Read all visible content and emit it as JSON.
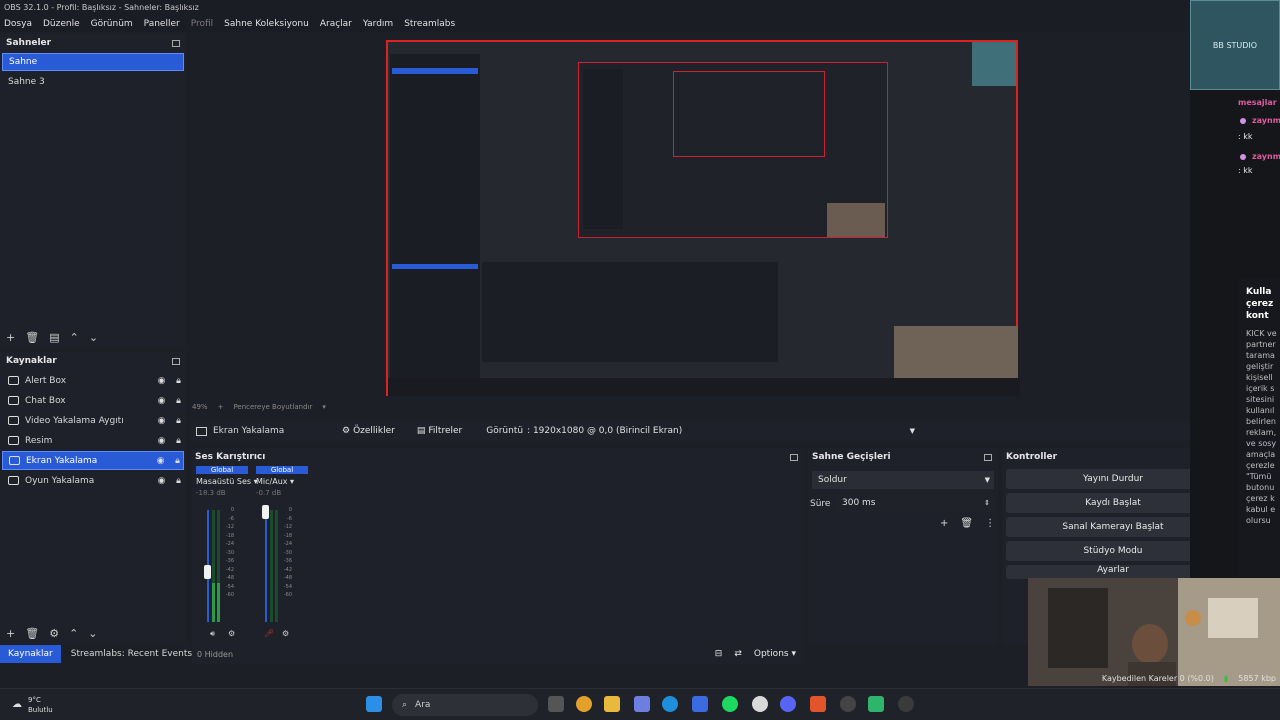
{
  "window": {
    "title": "OBS 32.1.0 - Profil: Başlıksız - Sahneler: Başlıksız"
  },
  "menu": [
    "Dosya",
    "Düzenle",
    "Görünüm",
    "Paneller",
    "Profil",
    "Sahne Koleksiyonu",
    "Araçlar",
    "Yardım",
    "Streamlabs"
  ],
  "scenes": {
    "title": "Sahneler",
    "items": [
      {
        "label": "Sahne",
        "selected": true
      },
      {
        "label": "Sahne 3",
        "selected": false
      }
    ]
  },
  "sources": {
    "title": "Kaynaklar",
    "items": [
      {
        "label": "Alert Box",
        "icon": "browser-icon"
      },
      {
        "label": "Chat Box",
        "icon": "browser-icon"
      },
      {
        "label": "Video Yakalama Aygıtı",
        "icon": "camera-icon"
      },
      {
        "label": "Resim",
        "icon": "image-icon"
      },
      {
        "label": "Ekran Yakalama",
        "icon": "monitor-icon",
        "selected": true
      },
      {
        "label": "Oyun Yakalama",
        "icon": "gamepad-icon"
      }
    ]
  },
  "dock_tabs": [
    "Kaynaklar",
    "Streamlabs: Recent Events"
  ],
  "preview": {
    "zoom": "49%",
    "mode_label": "Pencereye Boyutlandır"
  },
  "context_bar": {
    "source_name": "Ekran Yakalama",
    "properties": "Özellikler",
    "filters": "Filtreler",
    "display_label": "Görüntü",
    "display_value": ": 1920x1080 @ 0,0 (Birincil Ekran)"
  },
  "mixer": {
    "title": "Ses Karıştırıcı",
    "channels": [
      {
        "badge": "Global",
        "name": "Masaüstü Ses",
        "db": "-18.3 dB",
        "level": 0.35,
        "fader": 0.45
      },
      {
        "badge": "Global",
        "name": "Mic/Aux",
        "db": "-0.7 dB",
        "level": 0.0,
        "fader": 0.98
      }
    ],
    "scale": [
      "0",
      "-6",
      "-12",
      "-18",
      "-24",
      "-30",
      "-36",
      "-42",
      "-48",
      "-54",
      "-60"
    ],
    "hidden_label": "0 Hidden",
    "options_label": "Options"
  },
  "transitions": {
    "title": "Sahne Geçişleri",
    "selected": "Soldur",
    "duration_label": "Süre",
    "duration_value": "300 ms"
  },
  "controls": {
    "title": "Kontroller",
    "buttons": [
      "Yayını Durdur",
      "Kaydı Başlat",
      "Sanal Kamerayı Başlat",
      "Stüdyo Modu",
      "Ayarlar"
    ]
  },
  "chat": {
    "logo_text": "BB STUDIO",
    "lines": [
      {
        "user": "mesajlar",
        "text": ""
      },
      {
        "user": "zaynm",
        "text": ": kk"
      },
      {
        "user": "zaynm",
        "text": ": kk"
      }
    ]
  },
  "cookie_panel": {
    "heading": [
      "Kulla",
      "çerez",
      "kont"
    ],
    "body": [
      "KICK ve",
      "partner",
      "tarama",
      "geliştir",
      "kişisell",
      "içerik s",
      "sitesini",
      "kullanıl",
      "belirlen",
      "reklam,",
      "ve sosy",
      "amaçla",
      "çerezle",
      "\"Tümü",
      "butonu",
      "çerez k",
      "kabul e",
      "olursu"
    ]
  },
  "status": {
    "dropped_frames": "Kaybedilen Kareler 0 (%0.0)",
    "bitrate": "5857 kbp"
  },
  "taskbar": {
    "temperature": "9°C",
    "weather": "Bulutlu",
    "search": "Ara"
  },
  "colors": {
    "accent": "#2a5bd7",
    "preview_border": "#dd2222",
    "panel": "#1f212a"
  }
}
